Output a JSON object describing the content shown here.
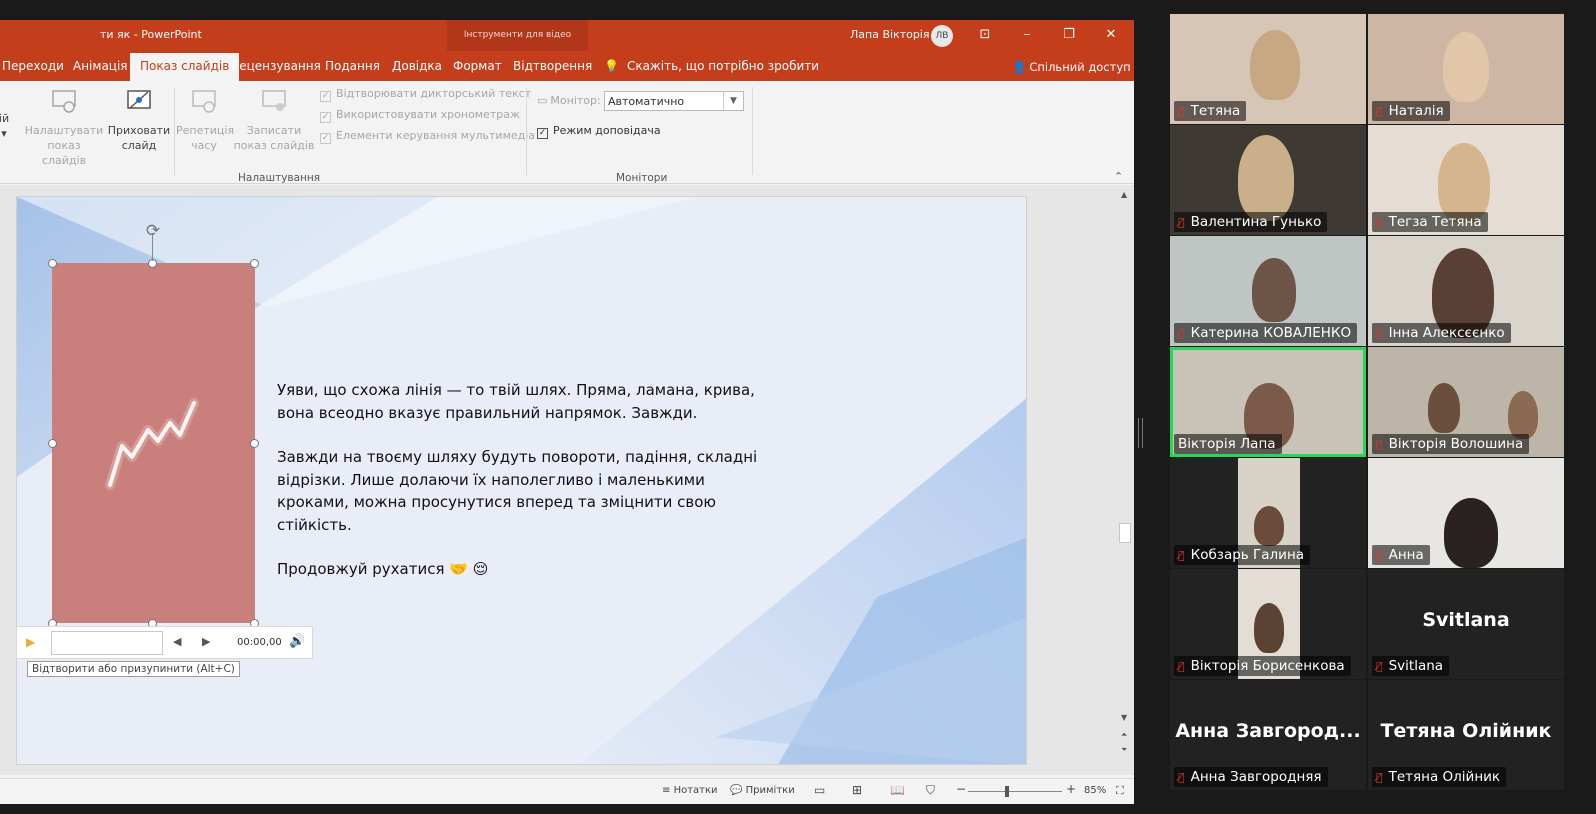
{
  "ppt": {
    "title": "ти як  -  PowerPoint",
    "context_tab_group": "Інструменти для відео",
    "user_name": "Лапа Вікторія",
    "user_initials": "ЛВ",
    "tabs": [
      "Переходи",
      "Анімація",
      "Показ слайдів",
      "Рецензування",
      "Подання",
      "Довідка",
      "Формат",
      "Відтворення"
    ],
    "active_tab": "Показ слайдів",
    "tell_me": "Скажіть, що потрібно зробити",
    "share": "Спільний доступ",
    "ribbon": {
      "setup_show": "Налаштувати показ слайдів",
      "hide_slide": "Приховати слайд",
      "rehearse": "Репетиція часу",
      "record": "Записати показ слайдів",
      "play_narration": "Відтворювати дикторський текст",
      "use_timings": "Використовувати хронометраж",
      "media_controls": "Елементи керування мультимедіа",
      "group_setup": "Налаштування",
      "monitor_label": "Монітор:",
      "monitor_value": "Автоматично",
      "presenter_view": "Режим доповідача",
      "group_monitors": "Монітори"
    },
    "slide": {
      "para1": "Уяви, що схожа лінія — то твій шлях. Пряма, ламана, крива, вона всеодно вказує правильний напрямок. Завжди.",
      "para2": "Завжди на твоєму шляху будуть повороти, падіння, складні відрізки. Лише долаючи їх наполегливо і маленькими кроками, можна просунутися вперед та зміцнити свою стійкість.",
      "para3": "Продовжуй рухатися 🤝 😌"
    },
    "media": {
      "time": "00:00,00",
      "tooltip": "Відтворити або призупинити (Alt+C)"
    },
    "status": {
      "notes": "Нотатки",
      "comments": "Примітки",
      "zoom": "85%"
    }
  },
  "participants": [
    {
      "name": "Тетяна"
    },
    {
      "name": "Наталія"
    },
    {
      "name": "Валентина Гунько"
    },
    {
      "name": "Тегза Тетяна"
    },
    {
      "name": "Катерина КОВАЛЕНКО"
    },
    {
      "name": "Інна Алексєєнко"
    },
    {
      "name": "Вікторія Лапа"
    },
    {
      "name": "Вікторія Волошина"
    },
    {
      "name": "Кобзарь Галина"
    },
    {
      "name": "Анна"
    },
    {
      "name": "Вікторія Борисенкова"
    },
    {
      "name": "Svitlana",
      "big": "Svitlana"
    },
    {
      "name": "Анна Завгородняя",
      "big": "Анна Завгород..."
    },
    {
      "name": "Тетяна Олійник",
      "big": "Тетяна Олійник"
    }
  ]
}
